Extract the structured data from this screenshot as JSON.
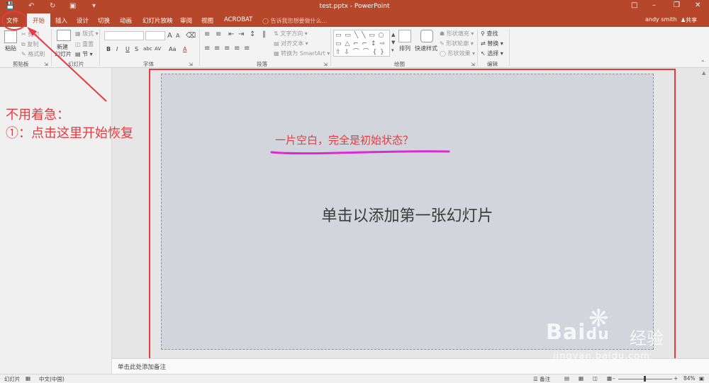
{
  "window": {
    "title": "test.pptx - PowerPoint",
    "user": "andy smith",
    "share": "共享"
  },
  "tabs": [
    "文件",
    "开始",
    "插入",
    "设计",
    "切换",
    "动画",
    "幻灯片放映",
    "审阅",
    "视图",
    "ACROBAT"
  ],
  "tell_me": "告诉我您想要做什么...",
  "ribbon": {
    "clipboard": {
      "label": "剪贴板",
      "paste": "粘贴",
      "cut": "剪切",
      "copy": "复制",
      "format_painter": "格式刷"
    },
    "slides": {
      "label": "幻灯片",
      "new_slide_1": "新建",
      "new_slide_2": "幻灯片",
      "layout": "版式",
      "reset": "重置",
      "section": "节"
    },
    "font": {
      "label": "字体",
      "bold": "B",
      "italic": "I",
      "underline": "U",
      "strike": "S",
      "shadow": "abc",
      "spacing": "AV",
      "case": "Aa",
      "color": "A"
    },
    "paragraph": {
      "label": "段落",
      "text_direction": "文字方向",
      "align_text": "对齐文本",
      "smartart": "转换为 SmartArt"
    },
    "drawing": {
      "label": "绘图",
      "arrange": "排列",
      "quick_styles": "快速样式",
      "shape_fill": "形状填充",
      "shape_outline": "形状轮廓",
      "shape_effects": "形状效果"
    },
    "editing": {
      "label": "编辑",
      "find": "查找",
      "replace": "替换",
      "select": "选择"
    }
  },
  "slide": {
    "placeholder": "单击以添加第一张幻灯片"
  },
  "notes": {
    "placeholder": "单击此处添加备注"
  },
  "status": {
    "slide": "幻灯片",
    "language": "中文(中国)",
    "notes": "备注",
    "zoom": "84%"
  },
  "annotations": {
    "line1": "不用着急：",
    "line2": "①：点击这里开始恢复",
    "middle": "一片空白，完全是初始状态？"
  },
  "watermark": {
    "brand": "Bai",
    "paw": "du",
    "sub": "经验",
    "url": "jingyan.baidu.com"
  },
  "colors": {
    "accent": "#b7472a",
    "annotation": "#e8393f",
    "underline": "#d92bd1"
  }
}
